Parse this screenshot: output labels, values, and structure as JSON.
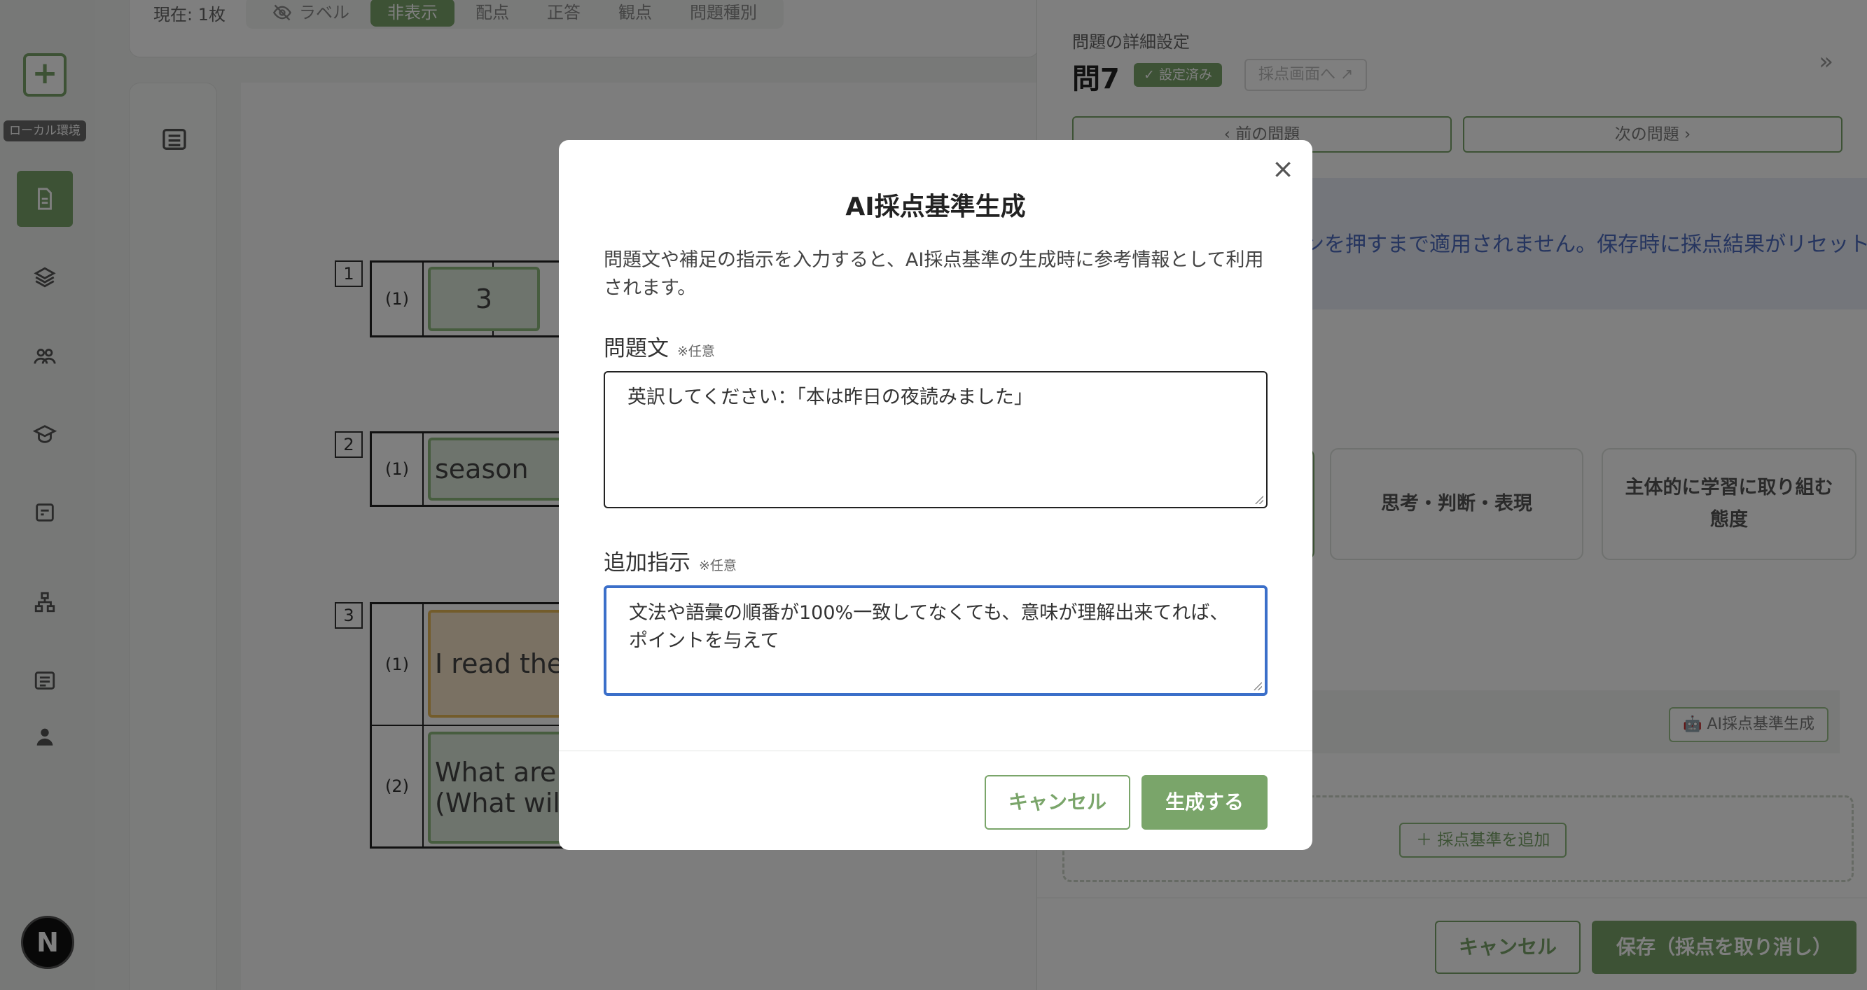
{
  "rail": {
    "env_label": "ローカル環境",
    "avatar_letter": "N"
  },
  "toolbar": {
    "count": "現在: 1枚",
    "view_modes": [
      {
        "label": "ラベル",
        "icon": "eye-off-icon"
      },
      {
        "label": "非表示",
        "active": true
      },
      {
        "label": "配点"
      },
      {
        "label": "正答"
      },
      {
        "label": "観点"
      },
      {
        "label": "問題種別"
      }
    ]
  },
  "sheet": {
    "questions": [
      {
        "num": "1",
        "rows": [
          {
            "label": "(1)",
            "answer": "3"
          }
        ]
      },
      {
        "num": "2",
        "rows": [
          {
            "label": "(1)",
            "answer": "season"
          }
        ]
      },
      {
        "num": "3",
        "rows": [
          {
            "label": "(1)",
            "answer": "I read the b"
          },
          {
            "label": "(2)",
            "answer_line1": "What are y",
            "answer_line2": "(What will y"
          }
        ]
      }
    ]
  },
  "panel": {
    "subtitle": "問題の詳細設定",
    "title": "問7",
    "badge": "設定済み",
    "grading_link": "採点画面へ",
    "prev": "前の問題",
    "next": "次の問題",
    "notice": "ンを押すまで適用されません。保存時に採点結果がリセットさ",
    "cards": [
      "思考・判断・表現",
      "主体的に学習に取り組む態度"
    ],
    "ai_button": "AI採点基準生成",
    "add_criteria": "採点基準を追加",
    "cancel": "キャンセル",
    "save": "保存（採点を取り消し）"
  },
  "modal": {
    "title": "AI採点基準生成",
    "description": "問題文や補足の指示を入力すると、AI採点基準の生成時に参考情報として利用されます。",
    "question_label": "問題文",
    "question_optional": "※任意",
    "question_value": "英訳してください：「本は昨日の夜読みました」",
    "extra_label": "追加指示",
    "extra_optional": "※任意",
    "extra_value": "文法や語彙の順番が100%一致してなくても、意味が理解出来てれば、ポイントを与えて",
    "cancel": "キャンセル",
    "generate": "生成する"
  },
  "colors": {
    "accent": "#7aa56a",
    "focus": "#3b6fc9",
    "notice_text": "#4c6bbf"
  }
}
